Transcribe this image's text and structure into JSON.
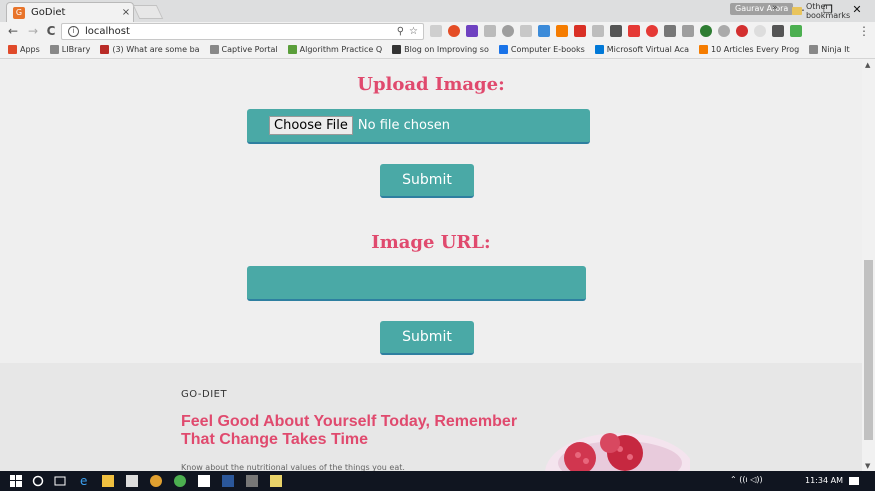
{
  "browser": {
    "tab_title": "GoDiet",
    "tab_favicon": "G",
    "tab_close": "×",
    "user_badge": "Gaurav Arora",
    "url": "localhost",
    "omnibox_info": "i",
    "nav": {
      "back": "←",
      "forward": "→",
      "reload": "C"
    },
    "window_controls": {
      "minimize": "—",
      "restore": "❐",
      "close": "✕"
    },
    "menu": "⋮",
    "bookmarks": [
      {
        "label": "Apps",
        "color": "#e04a2a"
      },
      {
        "label": "LIBrary",
        "color": "#888888"
      },
      {
        "label": "(3) What are some ba",
        "color": "#b92b27"
      },
      {
        "label": "Captive Portal",
        "color": "#888888"
      },
      {
        "label": "Algorithm Practice Q",
        "color": "#5a9e3a"
      },
      {
        "label": "Blog on Improving so",
        "color": "#333333"
      },
      {
        "label": "Computer E-books",
        "color": "#1a73e8"
      },
      {
        "label": "Microsoft Virtual Aca",
        "color": "#0078d7"
      },
      {
        "label": "10 Articles Every Prog",
        "color": "#f57c00"
      },
      {
        "label": "Ninja It",
        "color": "#888888"
      }
    ],
    "bookmarks_more": "»",
    "other_bookmarks": "Other bookmarks"
  },
  "page": {
    "upload_heading": "Upload Image:",
    "choose_file": "Choose File",
    "no_file": "No file chosen",
    "submit_1": "Submit",
    "url_heading": "Image URL:",
    "url_placeholder": "",
    "submit_2": "Submit"
  },
  "footer": {
    "brand": "GO-DIET",
    "tagline": "Feel Good About Yourself Today, Remember That Change Takes Time",
    "sub": "Know about the nutritional values of the things you eat."
  },
  "taskbar": {
    "tray_text": "⌃  ((ı  ◁))",
    "time": "11:34 AM"
  },
  "colors": {
    "accent_teal": "#4aa9a6",
    "heading_pink": "#e04a6e"
  }
}
